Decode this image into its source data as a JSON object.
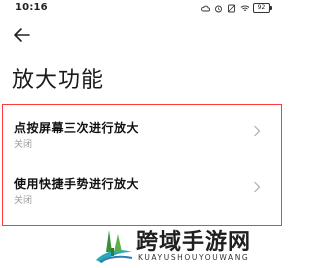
{
  "status_bar": {
    "time": "10:16",
    "battery": "92"
  },
  "header": {
    "title": "放大功能"
  },
  "settings": [
    {
      "title": "点按屏幕三次进行放大",
      "status": "关闭"
    },
    {
      "title": "使用快捷手势进行放大",
      "status": "关闭"
    }
  ],
  "watermark": {
    "name": "跨域手游网",
    "url": "KUAYUSHOUYOUWANG"
  },
  "colors": {
    "highlight_border": "#ff3b3b",
    "secondary_text": "#9a9a9a"
  }
}
